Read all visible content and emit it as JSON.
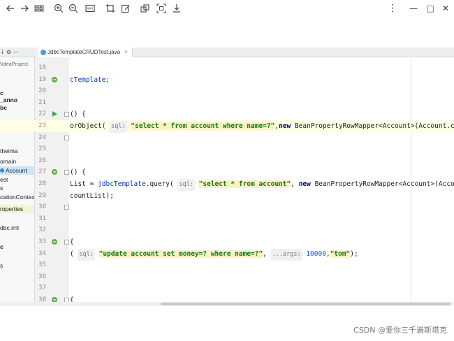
{
  "viewer_toolbar": {
    "icons": [
      "back-arrow-icon",
      "forward-arrow-icon",
      "grid-icon",
      "zoom-in-icon",
      "zoom-out-icon",
      "actual-size-icon",
      "crop-icon",
      "edit-icon",
      "copy-icon",
      "scan-icon",
      "download-icon"
    ],
    "more_label": "⋮",
    "minimize_label": "—",
    "maximize_label": "□",
    "close_label": "✕"
  },
  "ide": {
    "tab_label": "JdbcTemplateCRUDTest.java",
    "tab_close": "×",
    "project_tools": "↓  ✿  —",
    "project_items": [
      {
        "text": "\\IdeaProject",
        "style": "muted"
      },
      {
        "text": "c",
        "style": "bold"
      },
      {
        "text": "_anno",
        "style": "bold"
      },
      {
        "text": "bc",
        "style": "bold"
      },
      {
        "text": "theima",
        "style": ""
      },
      {
        "text": "omain",
        "style": ""
      },
      {
        "text": "Account",
        "style": "sel"
      },
      {
        "text": "est",
        "style": ""
      },
      {
        "text": "s",
        "style": ""
      },
      {
        "text": "cationContext",
        "style": ""
      },
      {
        "text": "roperties",
        "style": ""
      },
      {
        "text": "dbc.iml",
        "style": ""
      },
      {
        "text": "c",
        "style": "bold"
      },
      {
        "text": "s",
        "style": ""
      }
    ],
    "lines": [
      {
        "n": "18",
        "code": []
      },
      {
        "n": "19",
        "code": [
          {
            "t": "cTemplate;",
            "c": "method"
          }
        ]
      },
      {
        "n": "20",
        "code": []
      },
      {
        "n": "21",
        "code": []
      },
      {
        "n": "22",
        "code": [
          {
            "t": "() {",
            "c": ""
          }
        ]
      },
      {
        "n": "23",
        "code": [
          {
            "t": "orObject( ",
            "c": ""
          },
          {
            "t": "sql:",
            "c": "hint"
          },
          {
            "t": " ",
            "c": ""
          },
          {
            "t": "\"select * from account where name=?\"",
            "c": "str"
          },
          {
            "t": ",",
            "c": ""
          },
          {
            "t": "new",
            "c": "kw"
          },
          {
            "t": " BeanPropertyRowMapper<Account>(Account.class)",
            "c": ""
          }
        ]
      },
      {
        "n": "24",
        "code": []
      },
      {
        "n": "25",
        "code": []
      },
      {
        "n": "26",
        "code": []
      },
      {
        "n": "27",
        "code": [
          {
            "t": "() {",
            "c": ""
          }
        ]
      },
      {
        "n": "28",
        "code": [
          {
            "t": "List = ",
            "c": ""
          },
          {
            "t": "jdbcTemplate",
            "c": "method"
          },
          {
            "t": ".query( ",
            "c": ""
          },
          {
            "t": "sql:",
            "c": "hint"
          },
          {
            "t": " ",
            "c": ""
          },
          {
            "t": "\"select * from account\"",
            "c": "str"
          },
          {
            "t": ", ",
            "c": ""
          },
          {
            "t": "new",
            "c": "kw"
          },
          {
            "t": " BeanPropertyRowMapper<Account>(Account.c",
            "c": ""
          }
        ]
      },
      {
        "n": "29",
        "code": [
          {
            "t": "countList);",
            "c": ""
          }
        ]
      },
      {
        "n": "30",
        "code": []
      },
      {
        "n": "31",
        "code": []
      },
      {
        "n": "32",
        "code": []
      },
      {
        "n": "33",
        "code": [
          {
            "t": "{",
            "c": ""
          }
        ]
      },
      {
        "n": "34",
        "code": [
          {
            "t": "( ",
            "c": ""
          },
          {
            "t": "sql:",
            "c": "hint"
          },
          {
            "t": " ",
            "c": ""
          },
          {
            "t": "\"update account set money=? where name=?\"",
            "c": "str"
          },
          {
            "t": ", ",
            "c": ""
          },
          {
            "t": "...args:",
            "c": "hint"
          },
          {
            "t": " ",
            "c": ""
          },
          {
            "t": "10000",
            "c": "num"
          },
          {
            "t": ",",
            "c": ""
          },
          {
            "t": "\"tom\"",
            "c": "str"
          },
          {
            "t": ");",
            "c": ""
          }
        ]
      },
      {
        "n": "35",
        "code": []
      },
      {
        "n": "36",
        "code": []
      },
      {
        "n": "37",
        "code": []
      },
      {
        "n": "38",
        "code": [
          {
            "t": "{",
            "c": ""
          }
        ]
      }
    ]
  },
  "watermark": "CSDN @爱你三千遍斯塔克"
}
